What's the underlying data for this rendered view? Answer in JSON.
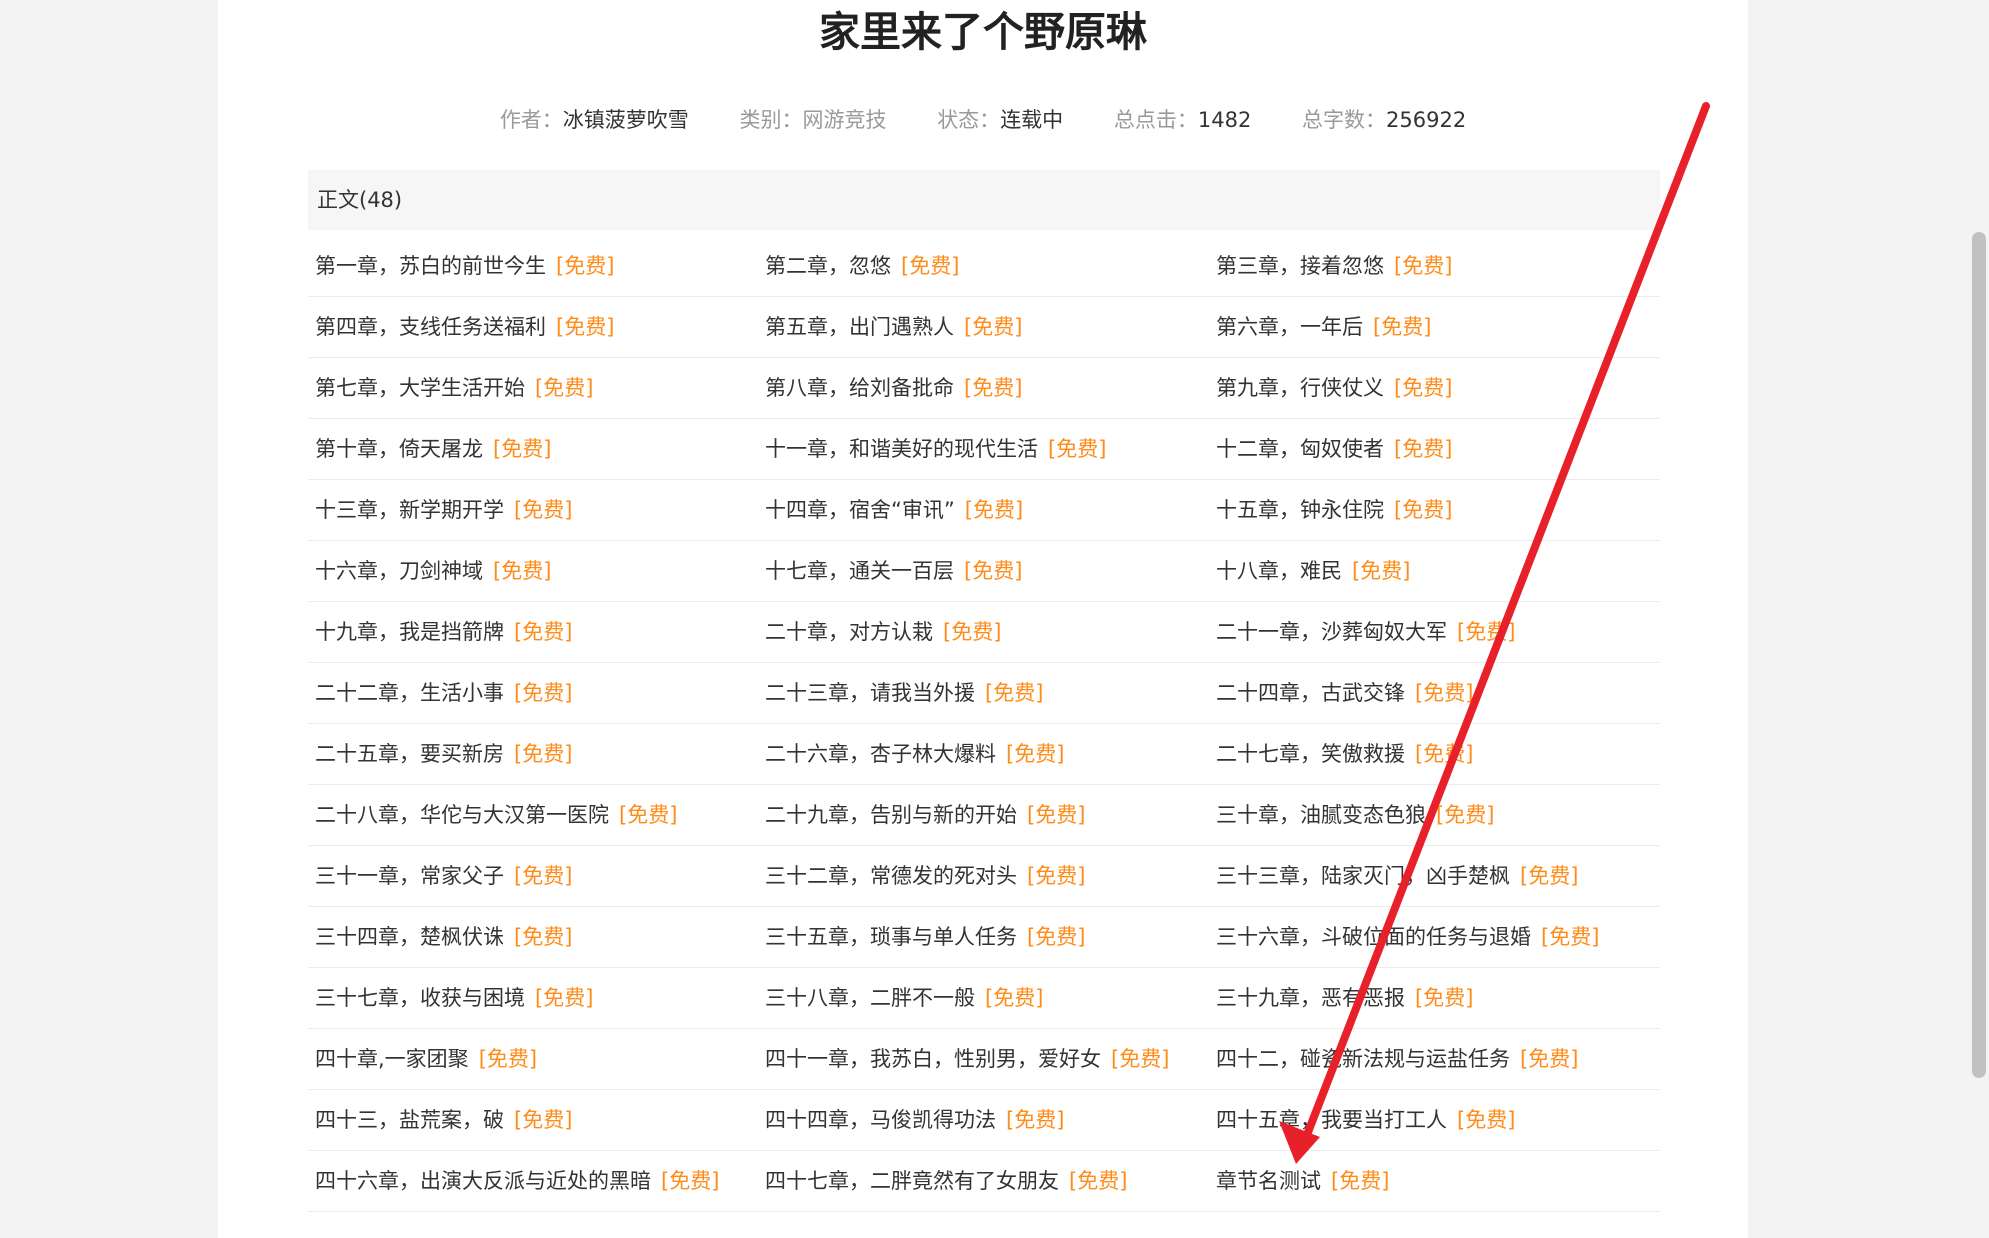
{
  "book": {
    "title": "家里来了个野原琳",
    "meta": [
      {
        "key": "作者：",
        "value": "冰镇菠萝吹雪"
      },
      {
        "key": "类别：",
        "value": "网游竞技"
      },
      {
        "key": "状态：",
        "value": "连载中"
      },
      {
        "key": "总点击：",
        "value": "1482"
      },
      {
        "key": "总字数：",
        "value": "256922"
      }
    ]
  },
  "section": {
    "header": "正文(48)"
  },
  "free_label": "[免费]",
  "chapters": [
    "第一章，苏白的前世今生",
    "第二章，忽悠",
    "第三章，接着忽悠",
    "第四章，支线任务送福利",
    "第五章，出门遇熟人",
    "第六章，一年后",
    "第七章，大学生活开始",
    "第八章，给刘备批命",
    "第九章，行侠仗义",
    "第十章，倚天屠龙",
    "十一章，和谐美好的现代生活",
    "十二章，匈奴使者",
    "十三章，新学期开学",
    "十四章，宿舍“审讯”",
    "十五章，钟永住院",
    "十六章，刀剑神域",
    "十七章，通关一百层",
    "十八章，难民",
    "十九章，我是挡箭牌",
    "二十章，对方认栽",
    "二十一章，沙葬匈奴大军",
    "二十二章，生活小事",
    "二十三章，请我当外援",
    "二十四章，古武交锋",
    "二十五章，要买新房",
    "二十六章，杏子林大爆料",
    "二十七章，笑傲救援",
    "二十八章，华佗与大汉第一医院",
    "二十九章，告别与新的开始",
    "三十章，油腻变态色狼",
    "三十一章，常家父子",
    "三十二章，常德发的死对头",
    "三十三章，陆家灭门，凶手楚枫",
    "三十四章，楚枫伏诛",
    "三十五章，琐事与单人任务",
    "三十六章，斗破位面的任务与退婚",
    "三十七章，收获与困境",
    "三十八章，二胖不一般",
    "三十九章，恶有恶报",
    "四十章,一家团聚",
    "四十一章，我苏白，性别男，爱好女",
    "四十二，碰瓷新法规与运盐任务",
    "四十三，盐荒案，破",
    "四十四章，马俊凯得功法",
    "四十五章，我要当打工人",
    "四十六章，出演大反派与近处的黑暗",
    "四十七章，二胖竟然有了女朋友",
    "章节名测试"
  ],
  "colors": {
    "free_accent": "#ff8c1a",
    "annotation_arrow": "#e8202a"
  }
}
